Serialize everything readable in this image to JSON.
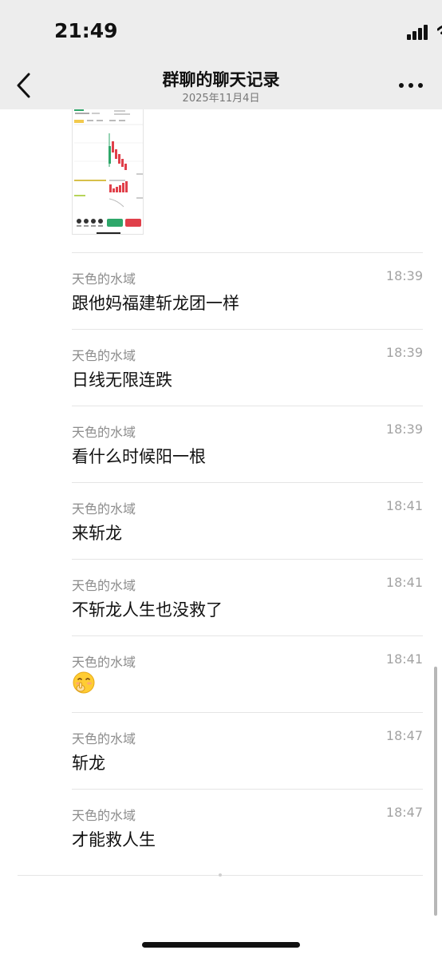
{
  "status_bar": {
    "time": "21:49",
    "icons": [
      "cellular-signal-icon",
      "wifi-icon",
      "battery-low-icon"
    ],
    "battery_color": "#ff3b30"
  },
  "header": {
    "title": "群聊的聊天记录",
    "subtitle": "2025年11月4日",
    "back_icon": "chevron-left-icon",
    "more_icon": "more-dots-icon"
  },
  "messages": [
    {
      "sender": "天色的水域",
      "time": "18:39",
      "text": "跟他妈福建斩龙团一样"
    },
    {
      "sender": "天色的水域",
      "time": "18:39",
      "text": "日线无限连跌"
    },
    {
      "sender": "天色的水域",
      "time": "18:39",
      "text": "看什么时候阳一根"
    },
    {
      "sender": "天色的水域",
      "time": "18:41",
      "text": "来斩龙"
    },
    {
      "sender": "天色的水域",
      "time": "18:41",
      "text": "不斩龙人生也没救了"
    },
    {
      "sender": "天色的水域",
      "time": "18:41",
      "text": "",
      "emoji": "shushing-face-emoji"
    },
    {
      "sender": "天色的水域",
      "time": "18:47",
      "text": "斩龙"
    },
    {
      "sender": "天色的水域",
      "time": "18:47",
      "text": "才能救人生"
    }
  ],
  "colors": {
    "header_bg": "#ededed",
    "chart_up": "#2ea76a",
    "chart_down": "#e0404a"
  }
}
